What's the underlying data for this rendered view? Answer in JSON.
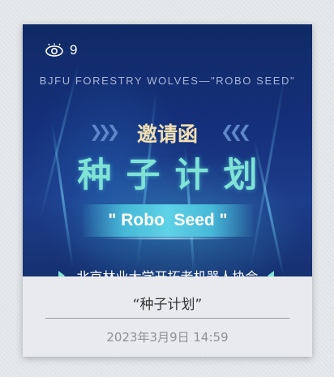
{
  "card": {
    "view_count": "9",
    "cover_english": "BJFU FORESTRY WOLVES—\"ROBO SEED\"",
    "cover_invite": "邀请函",
    "cover_title": "种子计划",
    "cover_banner": "\" Robo  Seed \"",
    "cover_org": "北京林业大学开拓者机器人协会",
    "caption_title": "“种子计划”",
    "caption_date": "2023年3月9日 14:59"
  },
  "icons": {
    "views": "eye-icon"
  },
  "colors": {
    "cover_bg": "#15307a",
    "title_cyan": "#7fe3d6",
    "invite_gold": "#f0dfb2",
    "banner": "#5ed2e6",
    "caption_bg": "#e9eaee"
  }
}
